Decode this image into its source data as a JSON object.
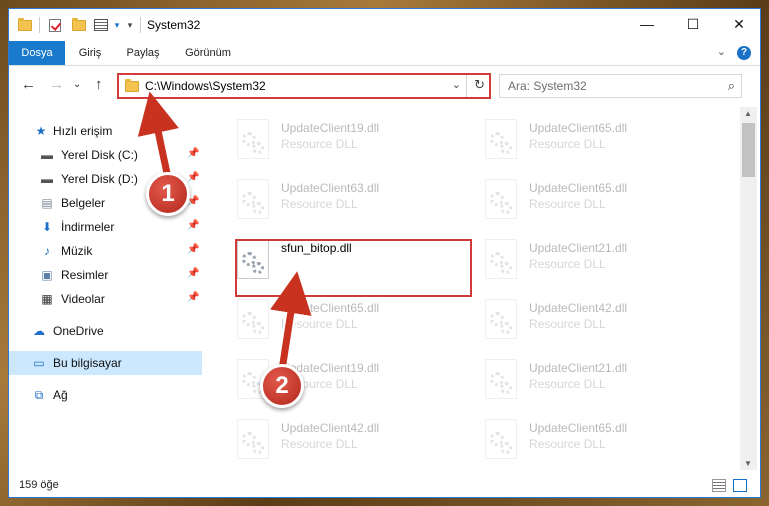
{
  "window": {
    "title": "System32",
    "minimize_glyph": "—",
    "maximize_glyph": "☐",
    "close_glyph": "✕"
  },
  "ribbon": {
    "tabs": [
      "Dosya",
      "Giriş",
      "Paylaş",
      "Görünüm"
    ],
    "collapse_glyph": "⌄",
    "help_glyph": "?"
  },
  "address": {
    "back_glyph": "←",
    "forward_glyph": "→",
    "dropdown_glyph": "⌄",
    "up_glyph": "↑",
    "path": "C:\\Windows\\System32",
    "refresh_glyph": "↻",
    "search_placeholder": "Ara: System32",
    "search_glyph": "⌕"
  },
  "sidebar": {
    "items": [
      {
        "label": "Hızlı erişim",
        "icon": "star-icon",
        "glyph": "★",
        "color": "#1a6fc7"
      },
      {
        "label": "Yerel Disk (C:)",
        "icon": "drive-icon",
        "glyph": "▬",
        "color": "#555555",
        "pinned": true
      },
      {
        "label": "Yerel Disk (D:)",
        "icon": "drive-icon",
        "glyph": "▬",
        "color": "#555555",
        "pinned": true
      },
      {
        "label": "Belgeler",
        "icon": "documents-icon",
        "glyph": "▤",
        "color": "#7a8a9a",
        "pinned": true
      },
      {
        "label": "İndirmeler",
        "icon": "download-icon",
        "glyph": "⬇",
        "color": "#1a6fc7",
        "pinned": true
      },
      {
        "label": "Müzik",
        "icon": "music-icon",
        "glyph": "♪",
        "color": "#1a6fc7",
        "pinned": true
      },
      {
        "label": "Resimler",
        "icon": "pictures-icon",
        "glyph": "▣",
        "color": "#5a7fa8",
        "pinned": true
      },
      {
        "label": "Videolar",
        "icon": "video-icon",
        "glyph": "▦",
        "color": "#333333",
        "pinned": true
      },
      {
        "label": "OneDrive",
        "icon": "cloud-icon",
        "glyph": "☁",
        "color": "#1a6fc7"
      },
      {
        "label": "Bu bilgisayar",
        "icon": "computer-icon",
        "glyph": "▭",
        "color": "#1a6fc7",
        "selected": true
      },
      {
        "label": "Ağ",
        "icon": "network-icon",
        "glyph": "⧉",
        "color": "#1a6fc7"
      }
    ],
    "pin_glyph": "📌"
  },
  "files": {
    "left_column": [
      {
        "name": "UpdateClient19.dll",
        "type": "Resource DLL",
        "faded": true
      },
      {
        "name": "UpdateClient63.dll",
        "type": "Resource DLL",
        "faded": true
      },
      {
        "name": "sfun_bitop.dll",
        "type": "",
        "faded": false
      },
      {
        "name": "UpdateClient65.dll",
        "type": "Resource DLL",
        "faded": true
      },
      {
        "name": "UpdateClient19.dll",
        "type": "Resource DLL",
        "faded": true
      },
      {
        "name": "UpdateClient42.dll",
        "type": "Resource DLL",
        "faded": true
      }
    ],
    "right_column": [
      {
        "name": "UpdateClient65.dll",
        "type": "Resource DLL",
        "faded": true
      },
      {
        "name": "UpdateClient65.dll",
        "type": "Resource DLL",
        "faded": true
      },
      {
        "name": "UpdateClient21.dll",
        "type": "Resource DLL",
        "faded": true
      },
      {
        "name": "UpdateClient42.dll",
        "type": "Resource DLL",
        "faded": true
      },
      {
        "name": "UpdateClient21.dll",
        "type": "Resource DLL",
        "faded": true
      },
      {
        "name": "UpdateClient65.dll",
        "type": "Resource DLL",
        "faded": true
      }
    ]
  },
  "scrollbar": {
    "up_glyph": "▲",
    "down_glyph": "▼"
  },
  "status": {
    "item_count": "159 öğe"
  },
  "annotations": {
    "step1": "1",
    "step2": "2",
    "accent_color": "#d23a3a"
  }
}
